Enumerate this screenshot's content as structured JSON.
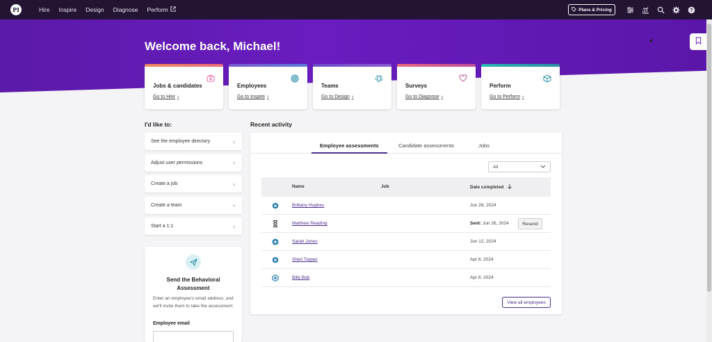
{
  "topbar": {
    "logo": "PI",
    "nav": [
      {
        "label": "Hire"
      },
      {
        "label": "Inspire"
      },
      {
        "label": "Design"
      },
      {
        "label": "Diagnose"
      },
      {
        "label": "Perform"
      }
    ],
    "plans_label": "Plans & Pricing"
  },
  "hero": {
    "welcome": "Welcome back, Michael!"
  },
  "cards": [
    {
      "title": "Jobs & candidates",
      "link": "Go to Hire",
      "accent": "#e96a7a",
      "icon_color": "#e86aa8"
    },
    {
      "title": "Employees",
      "link": "Go to Inspire",
      "accent": "#6a4ec8",
      "icon_color": "#2a8fa6"
    },
    {
      "title": "Teams",
      "link": "Go to Design",
      "accent": "#6a4ec8",
      "icon_color": "#2a8fa6"
    },
    {
      "title": "Surveys",
      "link": "Go to Diagnose",
      "accent": "#e96a7a",
      "icon_color": "#c0569a"
    },
    {
      "title": "Perform",
      "link": "Go to Perform",
      "accent": "#28b5b0",
      "icon_color": "#2a8fa6"
    }
  ],
  "actions": {
    "title": "I'd like to:",
    "items": [
      "See the employee directory",
      "Adjust user permissions",
      "Create a job",
      "Create a team",
      "Start a 1:1"
    ]
  },
  "send": {
    "title": "Send the Behavioral Assessment",
    "description": "Enter an employee's email address, and we'll invite them to take the assessment.",
    "email_label": "Employee email"
  },
  "activity": {
    "title": "Recent activity",
    "tabs": [
      "Employee assessments",
      "Candidate assessments",
      "Jobs"
    ],
    "filter": "All",
    "columns": {
      "name": "Name",
      "job": "Job",
      "date": "Date completed"
    },
    "rows": [
      {
        "name": "Brittany Hughes",
        "job": "",
        "date": "Jun 28, 2024",
        "icon": "behavior-pattern-icon"
      },
      {
        "name": "Matthew Reading",
        "job": "",
        "sent_label": "Sent:",
        "date": "Jun 26, 2024",
        "icon": "hourglass-icon",
        "action": "Resend"
      },
      {
        "name": "Sarah Jones",
        "job": "",
        "date": "Jun 12, 2024",
        "icon": "behavior-pattern-icon"
      },
      {
        "name": "Sheri Topper",
        "job": "",
        "date": "Apr 8, 2024",
        "icon": "behavior-pattern-icon"
      },
      {
        "name": "Billy Bob",
        "job": "",
        "date": "Apr 8, 2024",
        "icon": "behavior-pattern-icon"
      }
    ],
    "view_all": "View all employees"
  }
}
